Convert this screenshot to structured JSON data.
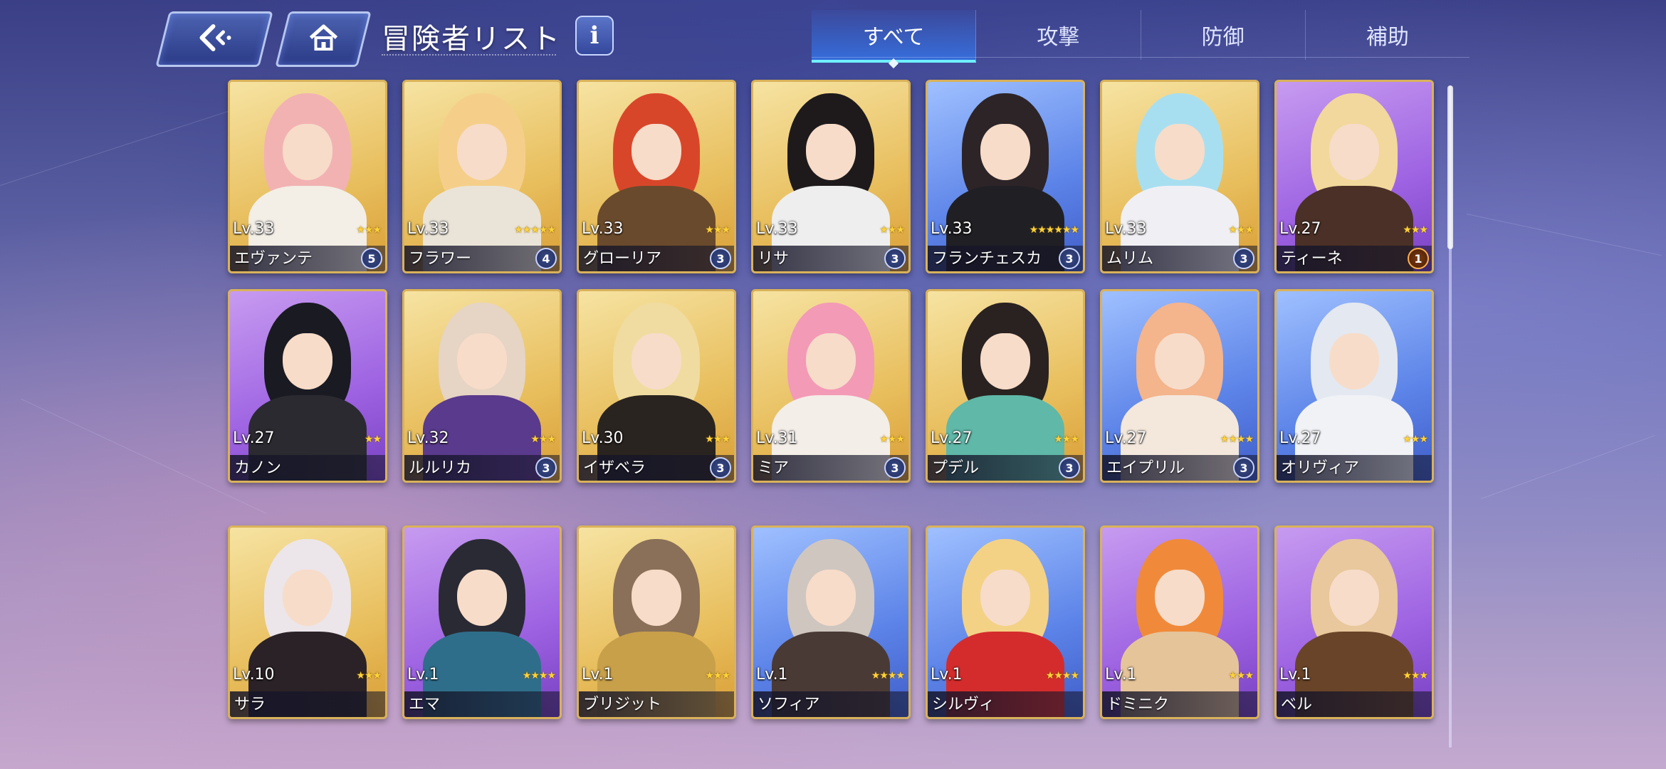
{
  "header": {
    "title": "冒険者リスト",
    "back_icon": "back-arrow-icon",
    "home_icon": "home-icon",
    "info_label": "i"
  },
  "tabs": [
    {
      "label": "すべて",
      "active": true
    },
    {
      "label": "攻撃",
      "active": false
    },
    {
      "label": "防御",
      "active": false
    },
    {
      "label": "補助",
      "active": false
    }
  ],
  "colors": {
    "gold_frame": "#e8be5d",
    "purple_frame": "#9d62e2",
    "blue_frame": "#5c83e8",
    "tab_active": "#6ef0ff"
  },
  "adventurers": [
    {
      "level": "Lv.33",
      "name": "エヴァンテ",
      "stars": 3,
      "badge": "5",
      "rarity": "gold",
      "hair": "#f2b2b2",
      "outfit": "#f3eee6"
    },
    {
      "level": "Lv.33",
      "name": "フラワー",
      "stars": 5,
      "badge": "4",
      "rarity": "gold",
      "hair": "#f5cf8a",
      "outfit": "#eae4d8"
    },
    {
      "level": "Lv.33",
      "name": "グローリア",
      "stars": 3,
      "badge": "3",
      "rarity": "gold",
      "hair": "#d8462a",
      "outfit": "#6a4a2c"
    },
    {
      "level": "Lv.33",
      "name": "リサ",
      "stars": 3,
      "badge": "3",
      "rarity": "gold",
      "hair": "#1e1a1c",
      "outfit": "#eeeeee"
    },
    {
      "level": "Lv.33",
      "name": "フランチェスカ",
      "stars": 6,
      "badge": "3",
      "rarity": "blue",
      "hair": "#2d2428",
      "outfit": "#202024"
    },
    {
      "level": "Lv.33",
      "name": "ムリム",
      "stars": 3,
      "badge": "3",
      "rarity": "gold",
      "hair": "#a8dff0",
      "outfit": "#f0f0f4"
    },
    {
      "level": "Lv.27",
      "name": "ティーネ",
      "stars": 3,
      "badge": "1",
      "rarity": "purple",
      "hair": "#f2d89c",
      "outfit": "#4a3026"
    },
    {
      "level": "Lv.27",
      "name": "カノン",
      "stars": 2,
      "badge": "",
      "rarity": "purple",
      "hair": "#1a1a22",
      "outfit": "#2a2a30"
    },
    {
      "level": "Lv.32",
      "name": "ルルリカ",
      "stars": 3,
      "badge": "3",
      "rarity": "gold",
      "hair": "#e6d4c4",
      "outfit": "#5a3a8c"
    },
    {
      "level": "Lv.30",
      "name": "イザベラ",
      "stars": 3,
      "badge": "3",
      "rarity": "gold",
      "hair": "#f0dca0",
      "outfit": "#2a2420"
    },
    {
      "level": "Lv.31",
      "name": "ミア",
      "stars": 3,
      "badge": "3",
      "rarity": "gold",
      "hair": "#f39ab6",
      "outfit": "#f4eee8"
    },
    {
      "level": "Lv.27",
      "name": "プデル",
      "stars": 3,
      "badge": "3",
      "rarity": "gold",
      "hair": "#2a2220",
      "outfit": "#5fb8a8"
    },
    {
      "level": "Lv.27",
      "name": "エイプリル",
      "stars": 4,
      "badge": "3",
      "rarity": "blue",
      "hair": "#f4b48c",
      "outfit": "#f4e8dc"
    },
    {
      "level": "Lv.27",
      "name": "オリヴィア",
      "stars": 3,
      "badge": "",
      "rarity": "blue",
      "hair": "#e4e8f0",
      "outfit": "#f0f2f6"
    },
    {
      "level": "Lv.10",
      "name": "サラ",
      "stars": 3,
      "badge": "",
      "rarity": "gold",
      "hair": "#ece6ea",
      "outfit": "#2a2226"
    },
    {
      "level": "Lv.1",
      "name": "エマ",
      "stars": 4,
      "badge": "",
      "rarity": "purple",
      "hair": "#2a2a34",
      "outfit": "#2f6e8a"
    },
    {
      "level": "Lv.1",
      "name": "ブリジット",
      "stars": 3,
      "badge": "",
      "rarity": "gold",
      "hair": "#8a7058",
      "outfit": "#c8a04a"
    },
    {
      "level": "Lv.1",
      "name": "ソフィア",
      "stars": 4,
      "badge": "",
      "rarity": "blue",
      "hair": "#cfc6c0",
      "outfit": "#4a3a36"
    },
    {
      "level": "Lv.1",
      "name": "シルヴィ",
      "stars": 4,
      "badge": "",
      "rarity": "blue",
      "hair": "#f3d286",
      "outfit": "#d42c2c"
    },
    {
      "level": "Lv.1",
      "name": "ドミニク",
      "stars": 3,
      "badge": "",
      "rarity": "purple",
      "hair": "#f08a3a",
      "outfit": "#e6c49a"
    },
    {
      "level": "Lv.1",
      "name": "ベル",
      "stars": 3,
      "badge": "",
      "rarity": "purple",
      "hair": "#e8c89c",
      "outfit": "#6a4428"
    }
  ]
}
